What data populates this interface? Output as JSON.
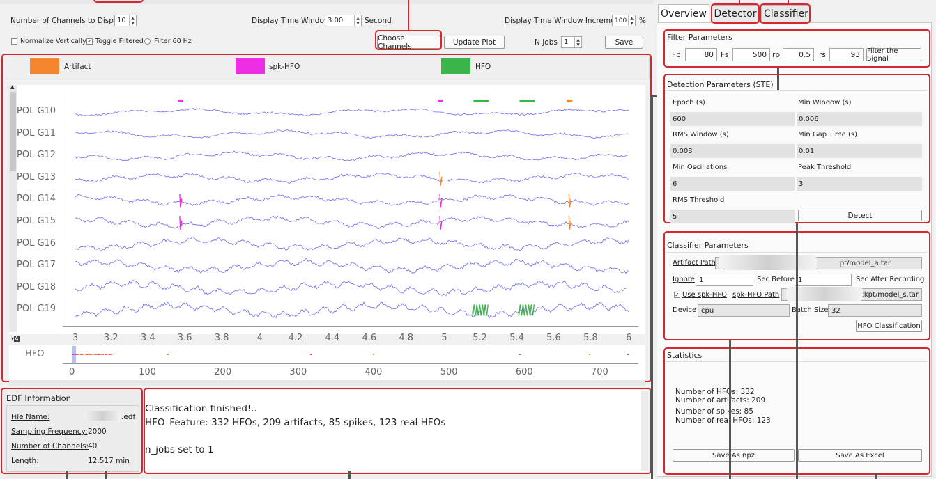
{
  "toolbar": {
    "num_channels_label": "Number of Channels to Display",
    "num_channels_value": "10",
    "time_window_label": "Display Time Window",
    "time_window_value": "3.00",
    "time_window_unit": "Second",
    "increment_label": "Display Time Window Increment",
    "increment_value": "100",
    "increment_unit": "%",
    "normalize_label": "Normalize Vertically",
    "normalize_checked": false,
    "toggle_filtered_label": "Toggle Filtered",
    "toggle_filtered_checked": true,
    "filter60_label": "Filter 60 Hz",
    "choose_channels_label": "Choose Channels",
    "update_plot_label": "Update Plot",
    "n_jobs_label": "N Jobs",
    "n_jobs_value": "1",
    "save_label": "Save"
  },
  "legend": [
    {
      "label": "Artifact",
      "color": "#f5862f"
    },
    {
      "label": "spk-HFO",
      "color": "#ee2ee2"
    },
    {
      "label": "HFO",
      "color": "#3bb54a"
    }
  ],
  "plot": {
    "trace_color": "#6b6bf0",
    "channels": [
      "POL G10",
      "POL G11",
      "POL G12",
      "POL G13",
      "POL G14",
      "POL G15",
      "POL G16",
      "POL G17",
      "POL G18",
      "POL G19"
    ],
    "x_ticks": [
      "3",
      "3.2",
      "3.4",
      "3.6",
      "3.8",
      "4",
      "4.2",
      "4.4",
      "4.6",
      "4.8",
      "5",
      "5.2",
      "5.4",
      "5.6",
      "5.8",
      "6"
    ],
    "overview_label": "HFO",
    "overview_ticks": [
      "0",
      "100",
      "200",
      "300",
      "400",
      "500",
      "600",
      "700"
    ],
    "a_button": "A"
  },
  "edf": {
    "title": "EDF Information",
    "file_name_label": "File Name:",
    "file_name_value": ".edf",
    "sampling_label": "Sampling Frequency:",
    "sampling_value": "2000",
    "channels_label": "Number of Channels:",
    "channels_value": "40",
    "length_label": "Length:",
    "length_value": "12.517 min"
  },
  "log": {
    "line1": "Classification finished!..",
    "line2": "HFO_Feature: 332 HFOs, 209 artifacts, 85 spikes, 123 real HFOs",
    "line3": "n_jobs set to 1"
  },
  "tabs": [
    "Overview",
    "Detector",
    "Classifier"
  ],
  "filter": {
    "title": "Filter Parameters",
    "fp_label": "Fp",
    "fp_value": "80",
    "fs_label": "Fs",
    "fs_value": "500",
    "rp_label": "rp",
    "rp_value": "0.5",
    "rs_label": "rs",
    "rs_value": "93",
    "button": "Filter the Signal"
  },
  "detection": {
    "title": "Detection Parameters (STE)",
    "epoch_label": "Epoch (s)",
    "epoch_value": "600",
    "min_window_label": "Min Window (s)",
    "min_window_value": "0.006",
    "rms_window_label": "RMS Window (s)",
    "rms_window_value": "0.003",
    "min_gap_label": "Min Gap Time (s)",
    "min_gap_value": "0.01",
    "min_osc_label": "Min Oscillations",
    "min_osc_value": "6",
    "peak_label": "Peak Threshold",
    "peak_value": "3",
    "rms_thresh_label": "RMS Threshold",
    "rms_thresh_value": "5",
    "detect_button": "Detect"
  },
  "classifier": {
    "title": "Classifier Parameters",
    "artifact_path_label": "Artifact Path",
    "artifact_path_value": "pt/model_a.tar",
    "ignore_label": "Ignore",
    "ignore_value": "1",
    "sec_before_label": "Sec Before",
    "sec_before_value": "1",
    "sec_after_label": "Sec After Recording",
    "use_spk_label": "Use spk-HFO",
    "use_spk_checked": true,
    "spk_path_label": "spk-HFO Path",
    "spk_path_value": "/ckpt/model_s.tar",
    "device_label": "Device",
    "device_value": "cpu",
    "batch_label": "Batch Size",
    "batch_value": "32",
    "classify_button": "HFO Classification"
  },
  "statistics": {
    "title": "Statistics",
    "line1": "Number of HFOs: 332",
    "line2": "Number of artifacts: 209",
    "line3": "Number of spikes: 85",
    "line4": "Number of real HFOs: 123",
    "save_npz": "Save As npz",
    "save_excel": "Save As Excel"
  },
  "chart_data": {
    "type": "line",
    "title": "",
    "xlabel": "",
    "ylabel": "",
    "xlim": [
      3,
      6
    ],
    "categories": [
      "POL G10",
      "POL G11",
      "POL G12",
      "POL G13",
      "POL G14",
      "POL G15",
      "POL G16",
      "POL G17",
      "POL G18",
      "POL G19"
    ],
    "events": [
      {
        "channel": "POL G14",
        "x": 3.57,
        "type": "spk-HFO"
      },
      {
        "channel": "POL G15",
        "x": 3.57,
        "type": "spk-HFO"
      },
      {
        "channel": "POL G13",
        "x": 4.98,
        "type": "Artifact"
      },
      {
        "channel": "POL G14",
        "x": 4.98,
        "type": "spk-HFO"
      },
      {
        "channel": "POL G15",
        "x": 4.98,
        "type": "spk-HFO"
      },
      {
        "channel": "POL G14",
        "x": 5.68,
        "type": "Artifact"
      },
      {
        "channel": "POL G15",
        "x": 5.68,
        "type": "Artifact"
      },
      {
        "channel": "POL G19",
        "x": 5.2,
        "type": "HFO"
      },
      {
        "channel": "POL G19",
        "x": 5.45,
        "type": "HFO"
      }
    ],
    "overview_xlim": [
      0,
      750
    ]
  }
}
